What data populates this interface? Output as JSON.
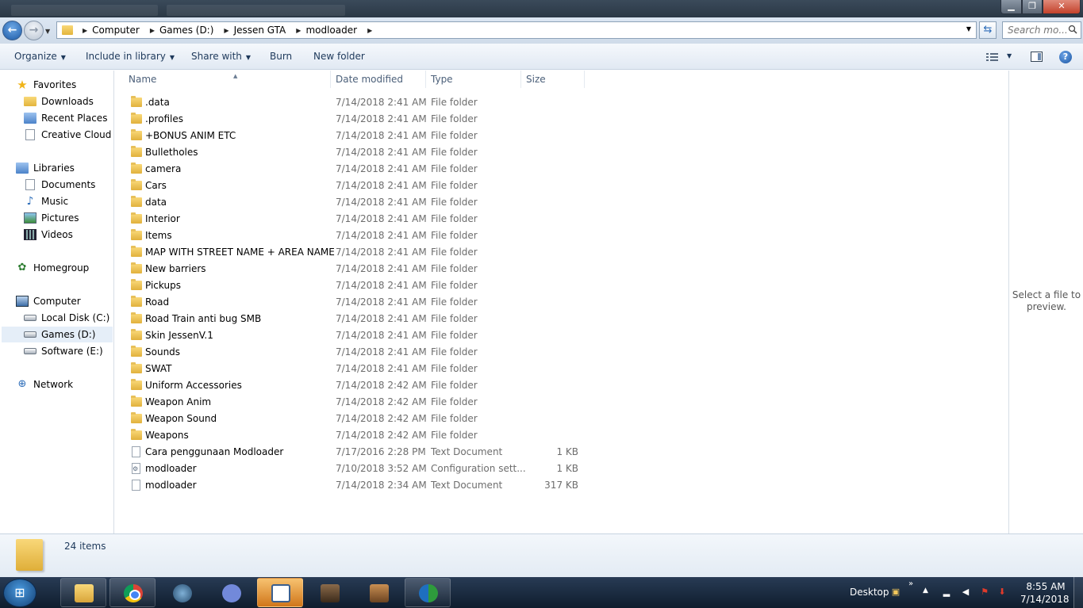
{
  "window": {
    "minimize_glyph": "▁",
    "maximize_glyph": "❐",
    "close_glyph": "✕"
  },
  "address": {
    "crumbs": [
      "Computer",
      "Games (D:)",
      "Jessen GTA",
      "modloader"
    ],
    "separator_glyph": "▶",
    "dropdown_glyph": "▼"
  },
  "search": {
    "placeholder": "Search mo..."
  },
  "toolbar": {
    "organize": "Organize",
    "include_in_library": "Include in library",
    "share_with": "Share with",
    "burn": "Burn",
    "new_folder": "New folder",
    "dropdown_glyph": "▼",
    "help_glyph": "?"
  },
  "nav": {
    "favorites": "Favorites",
    "downloads": "Downloads",
    "recent_places": "Recent Places",
    "creative_cloud": "Creative Cloud Fi",
    "libraries": "Libraries",
    "documents": "Documents",
    "music": "Music",
    "pictures": "Pictures",
    "videos": "Videos",
    "homegroup": "Homegroup",
    "computer": "Computer",
    "local_disk": "Local Disk (C:)",
    "games": "Games (D:)",
    "software": "Software (E:)",
    "network": "Network"
  },
  "columns": {
    "name": "Name",
    "date_modified": "Date modified",
    "type": "Type",
    "size": "Size",
    "sort_glyph": "▲"
  },
  "files": [
    {
      "name": ".data",
      "date": "7/14/2018 2:41 AM",
      "type": "File folder",
      "size": "",
      "kind": "folder"
    },
    {
      "name": ".profiles",
      "date": "7/14/2018 2:41 AM",
      "type": "File folder",
      "size": "",
      "kind": "folder"
    },
    {
      "name": "+BONUS ANIM ETC",
      "date": "7/14/2018 2:41 AM",
      "type": "File folder",
      "size": "",
      "kind": "folder"
    },
    {
      "name": "Bulletholes",
      "date": "7/14/2018 2:41 AM",
      "type": "File folder",
      "size": "",
      "kind": "folder"
    },
    {
      "name": "camera",
      "date": "7/14/2018 2:41 AM",
      "type": "File folder",
      "size": "",
      "kind": "folder"
    },
    {
      "name": "Cars",
      "date": "7/14/2018 2:41 AM",
      "type": "File folder",
      "size": "",
      "kind": "folder"
    },
    {
      "name": "data",
      "date": "7/14/2018 2:41 AM",
      "type": "File folder",
      "size": "",
      "kind": "folder"
    },
    {
      "name": "Interior",
      "date": "7/14/2018 2:41 AM",
      "type": "File folder",
      "size": "",
      "kind": "folder"
    },
    {
      "name": "Items",
      "date": "7/14/2018 2:41 AM",
      "type": "File folder",
      "size": "",
      "kind": "folder"
    },
    {
      "name": "MAP WITH STREET NAME + AREA NAME",
      "date": "7/14/2018 2:41 AM",
      "type": "File folder",
      "size": "",
      "kind": "folder"
    },
    {
      "name": "New barriers",
      "date": "7/14/2018 2:41 AM",
      "type": "File folder",
      "size": "",
      "kind": "folder"
    },
    {
      "name": "Pickups",
      "date": "7/14/2018 2:41 AM",
      "type": "File folder",
      "size": "",
      "kind": "folder"
    },
    {
      "name": "Road",
      "date": "7/14/2018 2:41 AM",
      "type": "File folder",
      "size": "",
      "kind": "folder"
    },
    {
      "name": "Road Train anti bug SMB",
      "date": "7/14/2018 2:41 AM",
      "type": "File folder",
      "size": "",
      "kind": "folder"
    },
    {
      "name": "Skin JessenV.1",
      "date": "7/14/2018 2:41 AM",
      "type": "File folder",
      "size": "",
      "kind": "folder"
    },
    {
      "name": "Sounds",
      "date": "7/14/2018 2:41 AM",
      "type": "File folder",
      "size": "",
      "kind": "folder"
    },
    {
      "name": "SWAT",
      "date": "7/14/2018 2:41 AM",
      "type": "File folder",
      "size": "",
      "kind": "folder"
    },
    {
      "name": "Uniform Accessories",
      "date": "7/14/2018 2:42 AM",
      "type": "File folder",
      "size": "",
      "kind": "folder"
    },
    {
      "name": "Weapon Anim",
      "date": "7/14/2018 2:42 AM",
      "type": "File folder",
      "size": "",
      "kind": "folder"
    },
    {
      "name": "Weapon Sound",
      "date": "7/14/2018 2:42 AM",
      "type": "File folder",
      "size": "",
      "kind": "folder"
    },
    {
      "name": "Weapons",
      "date": "7/14/2018 2:42 AM",
      "type": "File folder",
      "size": "",
      "kind": "folder"
    },
    {
      "name": "Cara penggunaan Modloader",
      "date": "7/17/2016 2:28 PM",
      "type": "Text Document",
      "size": "1 KB",
      "kind": "doc"
    },
    {
      "name": "modloader",
      "date": "7/10/2018 3:52 AM",
      "type": "Configuration sett...",
      "size": "1 KB",
      "kind": "cfg"
    },
    {
      "name": "modloader",
      "date": "7/14/2018 2:34 AM",
      "type": "Text Document",
      "size": "317 KB",
      "kind": "doc"
    }
  ],
  "preview": {
    "text": "Select a file to preview."
  },
  "details": {
    "item_count": "24 items"
  },
  "taskbar": {
    "start_glyph": "⊞",
    "desktop_label": "Desktop",
    "chevron": "»",
    "tray_up": "▲",
    "time": "8:55 AM",
    "date": "7/14/2018"
  },
  "colors": {
    "accent": "#1e395b",
    "selection": "#e5eef8",
    "folder": "#f9d879"
  }
}
